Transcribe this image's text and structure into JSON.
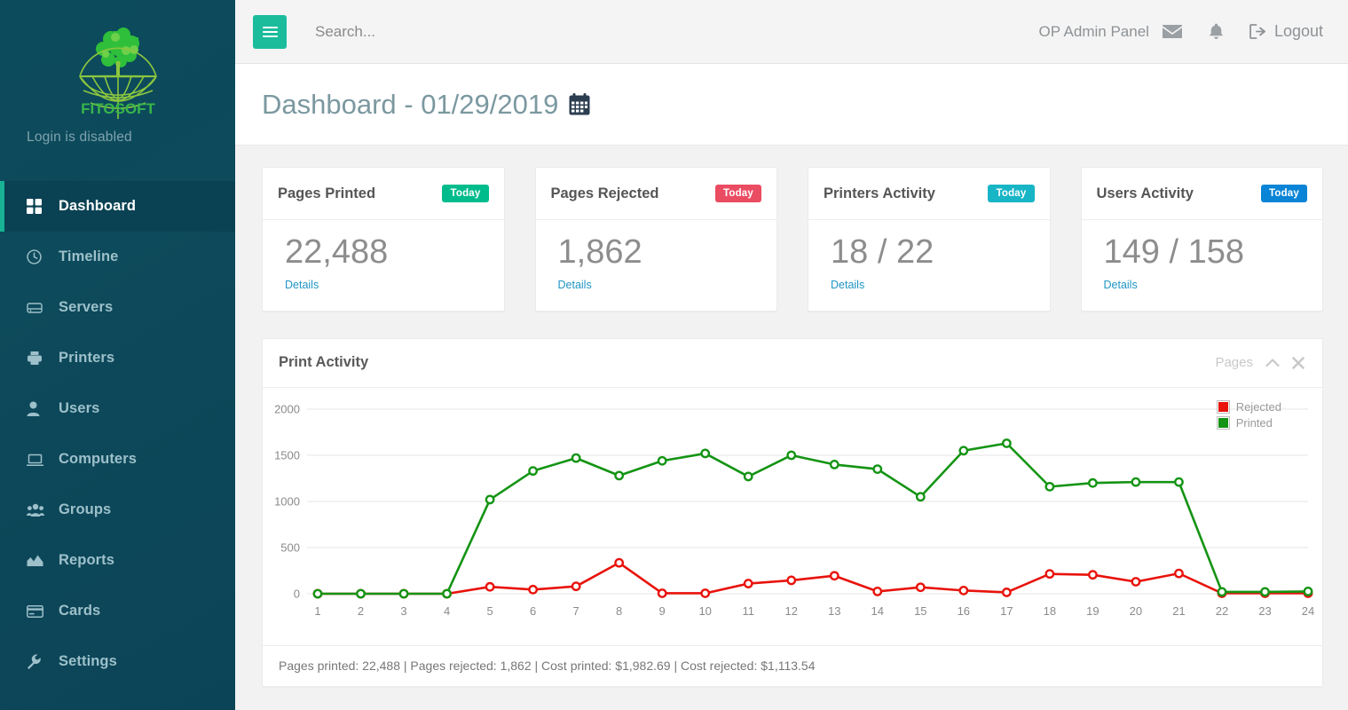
{
  "sidebar": {
    "logo_text": "FITOSOFT",
    "tagline": "Login is disabled",
    "items": [
      {
        "label": "Dashboard",
        "icon": "grid-icon",
        "active": true
      },
      {
        "label": "Timeline",
        "icon": "clock-icon",
        "active": false
      },
      {
        "label": "Servers",
        "icon": "server-icon",
        "active": false
      },
      {
        "label": "Printers",
        "icon": "printer-icon",
        "active": false
      },
      {
        "label": "Users",
        "icon": "user-icon",
        "active": false
      },
      {
        "label": "Computers",
        "icon": "laptop-icon",
        "active": false
      },
      {
        "label": "Groups",
        "icon": "users-group-icon",
        "active": false
      },
      {
        "label": "Reports",
        "icon": "chart-area-icon",
        "active": false
      },
      {
        "label": "Cards",
        "icon": "credit-card-icon",
        "active": false
      },
      {
        "label": "Settings",
        "icon": "wrench-icon",
        "active": false
      }
    ]
  },
  "topbar": {
    "menu_icon": "hamburger-icon",
    "search_placeholder": "Search...",
    "search_value": "",
    "admin_label": "OP Admin Panel",
    "mail_icon": "envelope-icon",
    "bell_icon": "bell-icon",
    "logout_icon": "sign-out-icon",
    "logout_label": "Logout"
  },
  "page": {
    "title": "Dashboard - 01/29/2019",
    "calendar_icon": "calendar-icon"
  },
  "cards": [
    {
      "title": "Pages Printed",
      "badge": "Today",
      "badge_color": "#00bc8c",
      "value": "22,488",
      "link": "Details"
    },
    {
      "title": "Pages Rejected",
      "badge": "Today",
      "badge_color": "#ea4c62",
      "value": "1,862",
      "link": "Details"
    },
    {
      "title": "Printers Activity",
      "badge": "Today",
      "badge_color": "#17b5c6",
      "value": "18 / 22",
      "link": "Details"
    },
    {
      "title": "Users Activity",
      "badge": "Today",
      "badge_color": "#0984d6",
      "value": "149 / 158",
      "link": "Details"
    }
  ],
  "panel": {
    "title": "Print Activity",
    "unit_label": "Pages",
    "collapse_icon": "chevron-up-icon",
    "close_icon": "close-icon",
    "footer": "Pages printed: 22,488 | Pages rejected: 1,862 | Cost printed: $1,982.69 | Cost rejected: $1,113.54"
  },
  "chart_data": {
    "type": "line",
    "title": "Print Activity",
    "xlabel": "",
    "ylabel": "Pages",
    "x": [
      1,
      2,
      3,
      4,
      5,
      6,
      7,
      8,
      9,
      10,
      11,
      12,
      13,
      14,
      15,
      16,
      17,
      18,
      19,
      20,
      21,
      22,
      23,
      24
    ],
    "xtick_labels": [
      "1",
      "2",
      "3",
      "4",
      "5",
      "6",
      "7",
      "8",
      "9",
      "10",
      "11",
      "12",
      "13",
      "14",
      "15",
      "16",
      "17",
      "18",
      "19",
      "20",
      "21",
      "22",
      "23",
      "24"
    ],
    "ytick_labels": [
      "0",
      "500",
      "1000",
      "1500",
      "2000"
    ],
    "yticks": [
      0,
      500,
      1000,
      1500,
      2000
    ],
    "ylim": [
      0,
      2000
    ],
    "grid": true,
    "legend_position": "top-right",
    "series": [
      {
        "name": "Rejected",
        "color": "#e8130c",
        "values": [
          0,
          0,
          0,
          0,
          75,
          45,
          80,
          335,
          5,
          5,
          110,
          145,
          195,
          25,
          70,
          35,
          15,
          215,
          205,
          130,
          220,
          5,
          5,
          5
        ]
      },
      {
        "name": "Printed",
        "color": "#149414",
        "values": [
          0,
          0,
          0,
          0,
          1020,
          1330,
          1470,
          1280,
          1440,
          1520,
          1270,
          1500,
          1400,
          1350,
          1050,
          1550,
          1630,
          1160,
          1200,
          1210,
          1210,
          20,
          20,
          25
        ]
      }
    ]
  }
}
